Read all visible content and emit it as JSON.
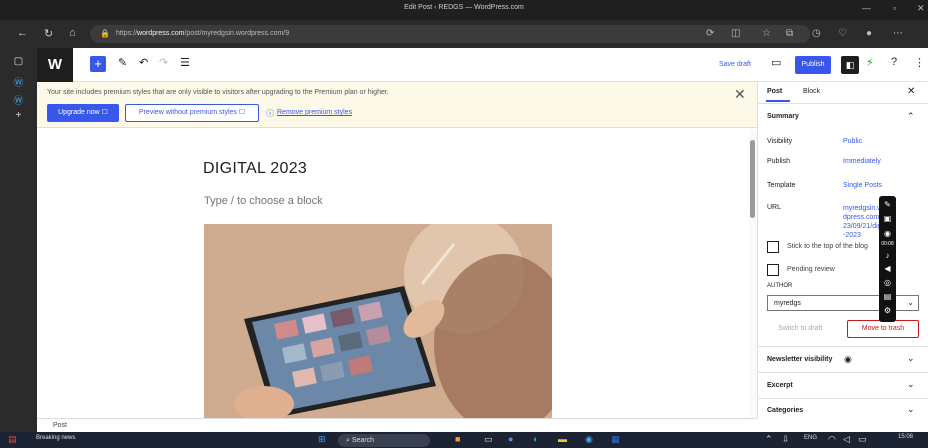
{
  "browser": {
    "title": "Edit Post ‹ REDGS — WordPress.com",
    "url_prefix": "https://",
    "url_domain": "wordpress.com",
    "url_path": "/post/myredgsin.wordpress.com/9"
  },
  "toolbar": {
    "save_draft": "Save draft",
    "publish": "Publish"
  },
  "notice": {
    "message": "Your site includes premium styles that are only visible to visitors after upgrading to the Premium plan or higher.",
    "upgrade": "Upgrade now ☐",
    "preview": "Preview without premium styles ☐",
    "remove": "Remove premium styles"
  },
  "editor": {
    "title": "DIGITAL 2023",
    "placeholder": "Type / to choose a block",
    "breadcrumb": "Post"
  },
  "sidebar": {
    "tab_post": "Post",
    "tab_block": "Block",
    "summary": "Summary",
    "visibility_label": "Visibility",
    "visibility_value": "Public",
    "publish_label": "Publish",
    "publish_value": "Immediately",
    "template_label": "Template",
    "template_value": "Single Posts",
    "url_label": "URL",
    "url_value": "myredgsin.wordpress.com/2023/09/21/digital-2023",
    "sticky": "Stick to the top of the blog",
    "pending": "Pending review",
    "author_label": "AUTHOR",
    "author_value": "myredgs",
    "switch_draft": "Switch to draft",
    "move_trash": "Move to trash",
    "newsletter": "Newsletter visibility",
    "excerpt": "Excerpt",
    "categories": "Categories"
  },
  "taskbar": {
    "news": "Breaking news",
    "search": "Search",
    "lang": "ENG",
    "time": "15:08"
  },
  "recorder": {
    "timer": "00:08"
  }
}
